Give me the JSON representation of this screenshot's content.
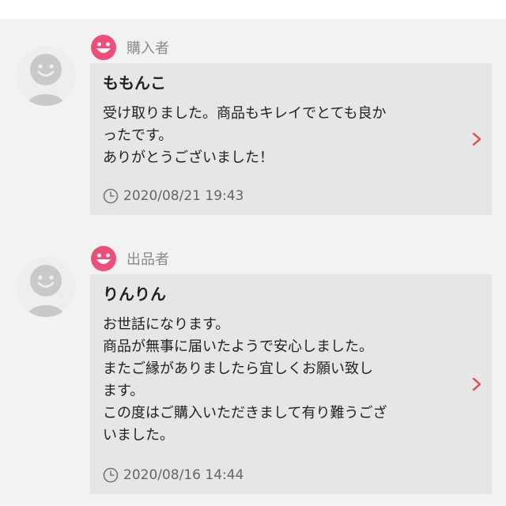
{
  "reviews": [
    {
      "role": "購入者",
      "name": "ももんこ",
      "message_lines": [
        "受け取りました。商品もキレイでとても良か",
        "ったです。",
        "ありがとうございました！"
      ],
      "date": "2020/08/21 19:43",
      "avatar_icon": "user-silhouette-icon",
      "role_icon": "smiley-face-icon"
    },
    {
      "role": "出品者",
      "name": "りんりん",
      "message_lines": [
        "お世話になります。",
        "商品が無事に届いたようで安心しました。",
        "またご縁がありましたら宜しくお願い致し",
        "ます。",
        "この度はご購入いただきまして有り難うござ",
        "いました。"
      ],
      "date": "2020/08/16 14:44",
      "avatar_icon": "user-silhouette-icon",
      "role_icon": "smiley-face-icon"
    }
  ],
  "colors": {
    "accent_pink": "#ee4f7a",
    "chevron_red": "#e24a4a",
    "bubble_bg": "#e6e6e6",
    "page_bg": "#f2f2f2"
  }
}
